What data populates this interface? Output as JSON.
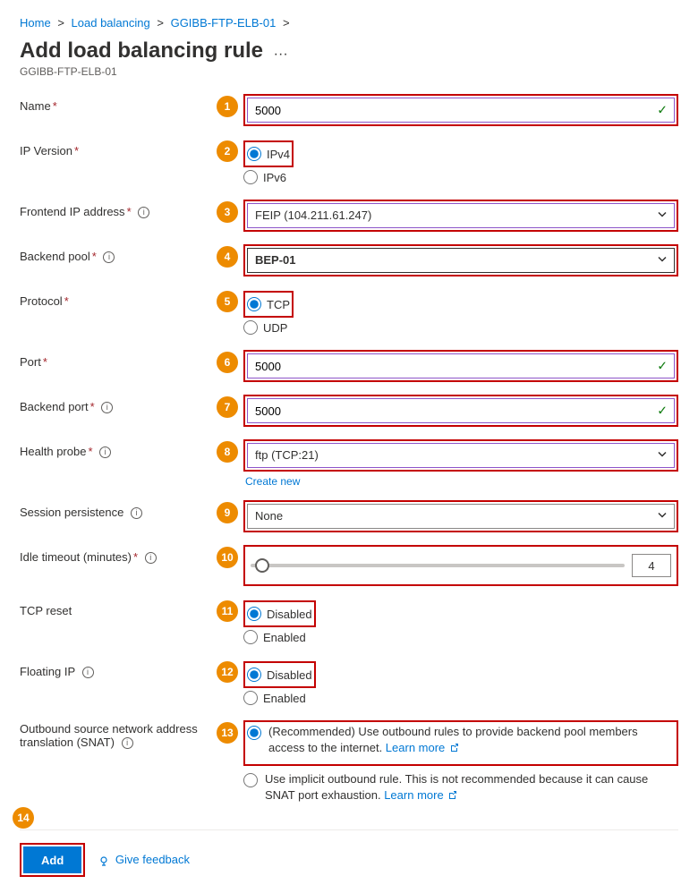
{
  "breadcrumb": [
    "Home",
    "Load balancing",
    "GGIBB-FTP-ELB-01"
  ],
  "title": "Add load balancing rule",
  "subtitle": "GGIBB-FTP-ELB-01",
  "labels": {
    "name": "Name",
    "ipversion": "IP Version",
    "frontend": "Frontend IP address",
    "backend": "Backend pool",
    "protocol": "Protocol",
    "port": "Port",
    "backendport": "Backend port",
    "healthprobe": "Health probe",
    "session": "Session persistence",
    "idle": "Idle timeout (minutes)",
    "tcpreset": "TCP reset",
    "floating": "Floating IP",
    "snat": "Outbound source network address translation (SNAT)"
  },
  "values": {
    "name": "5000",
    "frontend": "FEIP (104.211.61.247)",
    "backend": "BEP-01",
    "port": "5000",
    "backendport": "5000",
    "healthprobe": "ftp (TCP:21)",
    "session": "None",
    "idle": "4"
  },
  "options": {
    "ipversion": [
      "IPv4",
      "IPv6"
    ],
    "protocol": [
      "TCP",
      "UDP"
    ],
    "tcpreset": [
      "Disabled",
      "Enabled"
    ],
    "floating": [
      "Disabled",
      "Enabled"
    ],
    "snat": {
      "opt1_a": "(Recommended) Use outbound rules to provide backend pool members access to the internet. ",
      "opt1_link": "Learn more",
      "opt2_a": "Use implicit outbound rule. This is not recommended because it can cause SNAT port exhaustion. ",
      "opt2_link": "Learn more"
    }
  },
  "links": {
    "createnew": "Create new",
    "feedback": "Give feedback"
  },
  "buttons": {
    "add": "Add"
  },
  "steps": [
    "1",
    "2",
    "3",
    "4",
    "5",
    "6",
    "7",
    "8",
    "9",
    "10",
    "11",
    "12",
    "13",
    "14"
  ]
}
